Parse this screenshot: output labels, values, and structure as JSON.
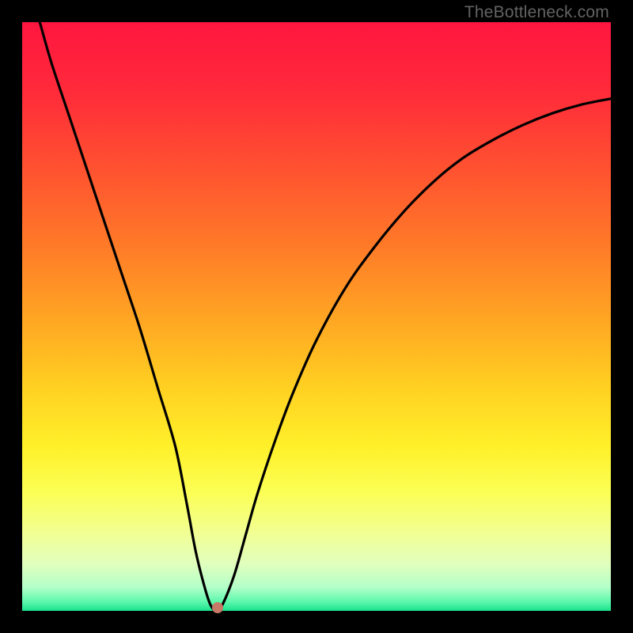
{
  "watermark": "TheBottleneck.com",
  "gradient": {
    "stops": [
      {
        "offset": "0%",
        "color": "#ff163f"
      },
      {
        "offset": "12%",
        "color": "#ff2b3a"
      },
      {
        "offset": "25%",
        "color": "#ff5230"
      },
      {
        "offset": "38%",
        "color": "#ff7a28"
      },
      {
        "offset": "50%",
        "color": "#ffa423"
      },
      {
        "offset": "62%",
        "color": "#ffd022"
      },
      {
        "offset": "72%",
        "color": "#fff029"
      },
      {
        "offset": "80%",
        "color": "#fbff56"
      },
      {
        "offset": "87%",
        "color": "#f1ff95"
      },
      {
        "offset": "92%",
        "color": "#e1ffbd"
      },
      {
        "offset": "96%",
        "color": "#b3ffc9"
      },
      {
        "offset": "98.5%",
        "color": "#5cf7ac"
      },
      {
        "offset": "100%",
        "color": "#19e28d"
      }
    ]
  },
  "chart_data": {
    "type": "line",
    "title": "",
    "xlabel": "",
    "ylabel": "",
    "xlim": [
      0,
      100
    ],
    "ylim": [
      0,
      100
    ],
    "series": [
      {
        "name": "bottleneck-curve",
        "x": [
          3,
          5,
          8,
          11,
          14,
          17,
          20,
          23,
          26,
          28,
          29.5,
          31,
          32,
          33,
          34,
          36,
          38,
          40,
          43,
          46,
          50,
          55,
          60,
          65,
          70,
          75,
          80,
          85,
          90,
          95,
          100
        ],
        "y": [
          100,
          93,
          84,
          75,
          66,
          57,
          48,
          38,
          28,
          18,
          10,
          4,
          1,
          0,
          1,
          6,
          13,
          20,
          29,
          37,
          46,
          55,
          62,
          68,
          73,
          77,
          80,
          82.5,
          84.5,
          86,
          87
        ]
      }
    ],
    "marker": {
      "x": 33.2,
      "y": 0.6
    }
  }
}
